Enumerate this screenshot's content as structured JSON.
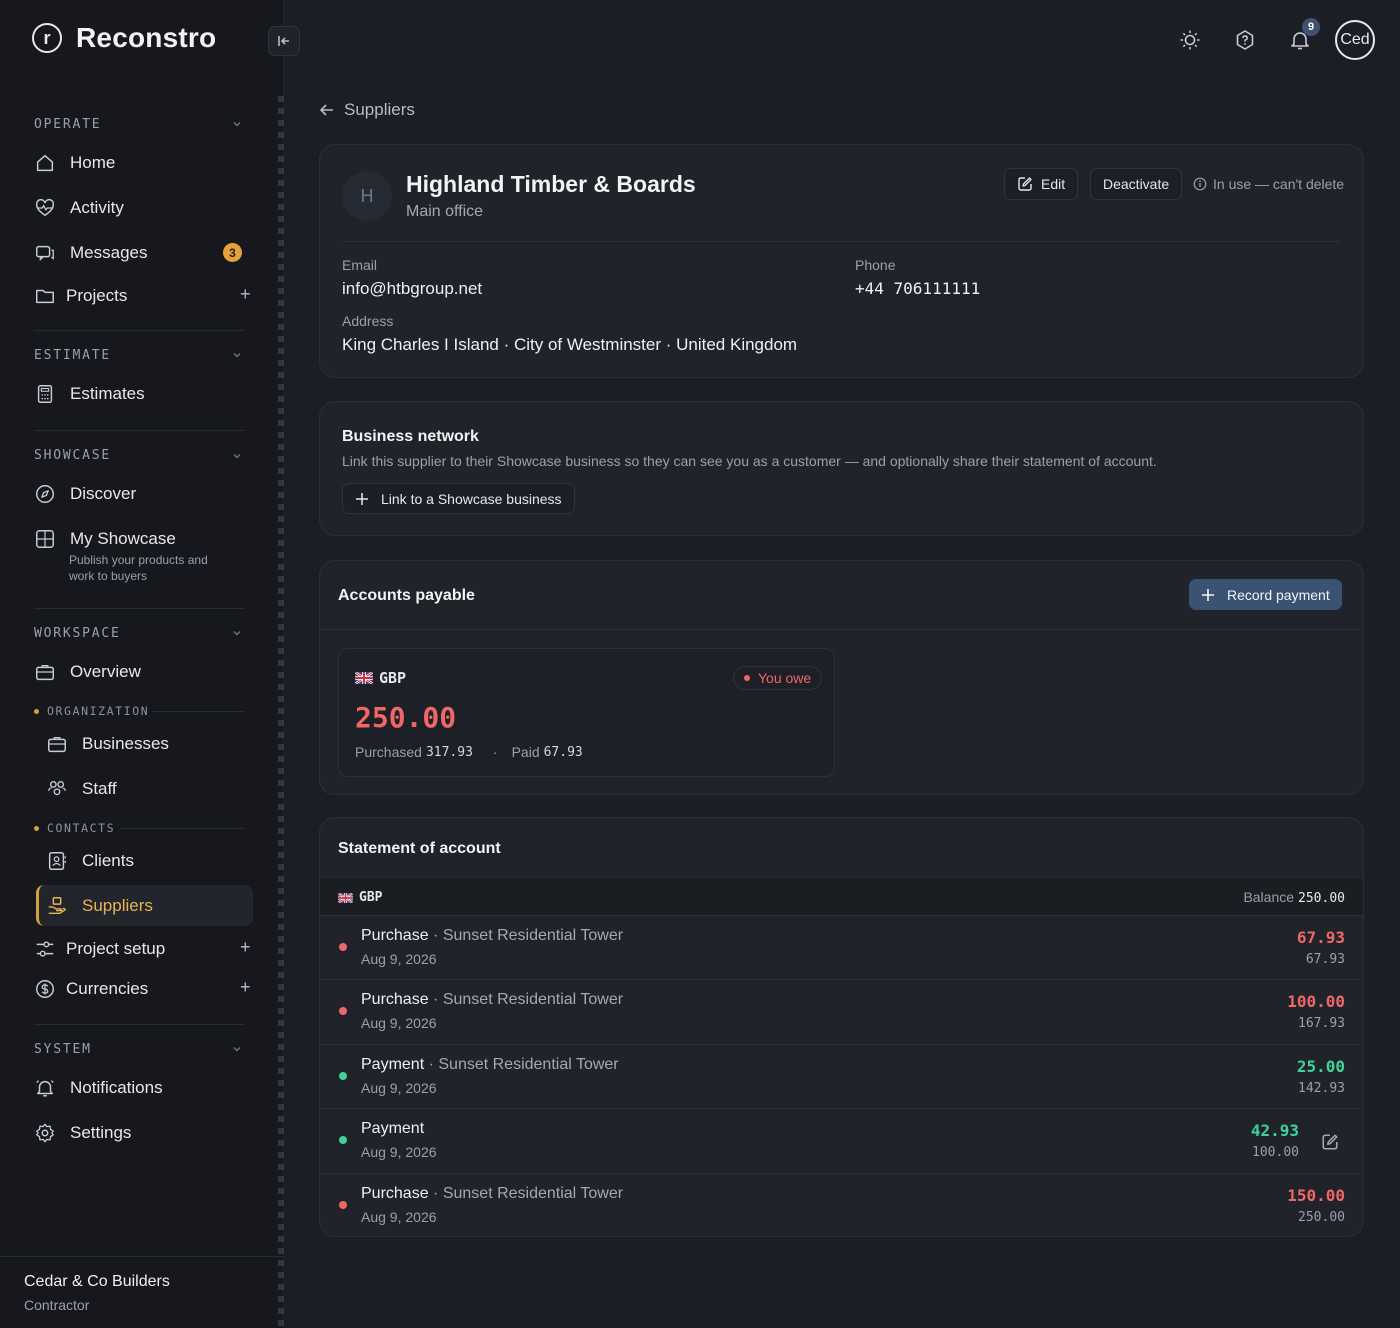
{
  "app": {
    "name": "Reconstro",
    "logo_letter": "r"
  },
  "sidebar": {
    "sections": {
      "operate": "OPERATE",
      "estimate": "ESTIMATE",
      "showcase": "SHOWCASE",
      "workspace": "WORKSPACE",
      "system": "SYSTEM"
    },
    "items": {
      "home": "Home",
      "activity": "Activity",
      "messages": "Messages",
      "messages_badge": "3",
      "projects": "Projects",
      "estimates": "Estimates",
      "discover": "Discover",
      "my_showcase": "My Showcase",
      "my_showcase_sub": "Publish your products and work to buyers",
      "overview": "Overview",
      "organization": "ORGANIZATION",
      "businesses": "Businesses",
      "staff": "Staff",
      "contacts": "CONTACTS",
      "clients": "Clients",
      "suppliers": "Suppliers",
      "project_setup": "Project setup",
      "currencies": "Currencies",
      "notifications": "Notifications",
      "settings": "Settings"
    },
    "plus": "+",
    "footer": {
      "org_name": "Cedar & Co Builders",
      "org_role": "Contractor"
    }
  },
  "topbar": {
    "notification_count": "9",
    "avatar_text": "Ced"
  },
  "breadcrumb": {
    "back_label": "Suppliers"
  },
  "supplier": {
    "avatar_letter": "H",
    "name": "Highland Timber & Boards",
    "subtitle": "Main office",
    "edit_label": "Edit",
    "deactivate_label": "Deactivate",
    "in_use_note": "In use — can't delete",
    "email_label": "Email",
    "email": "info@htbgroup.net",
    "phone_label": "Phone",
    "phone": "+44 706111111",
    "address_label": "Address",
    "address": "King Charles I Island · City of Westminster · United Kingdom"
  },
  "business_network": {
    "title": "Business network",
    "description": "Link this supplier to their Showcase business so they can see you as a customer — and optionally share their statement of account.",
    "link_button": "Link to a Showcase business"
  },
  "accounts_payable": {
    "title": "Accounts payable",
    "record_button": "Record payment",
    "currency": "GBP",
    "status": "You owe",
    "amount": "250.00",
    "purchased_label": "Purchased",
    "purchased": "317.93",
    "separator": "·",
    "paid_label": "Paid",
    "paid": "67.93"
  },
  "statement": {
    "title": "Statement of account",
    "currency": "GBP",
    "balance_label": "Balance",
    "balance": "250.00",
    "rows": [
      {
        "type": "Purchase",
        "project": "· Sunset Residential Tower",
        "date": "Aug 9, 2026",
        "amount": "67.93",
        "running": "67.93"
      },
      {
        "type": "Purchase",
        "project": "· Sunset Residential Tower",
        "date": "Aug 9, 2026",
        "amount": "100.00",
        "running": "167.93"
      },
      {
        "type": "Payment",
        "project": "· Sunset Residential Tower",
        "date": "Aug 9, 2026",
        "amount": "25.00",
        "running": "142.93"
      },
      {
        "type": "Payment",
        "project": "",
        "date": "Aug 9, 2026",
        "amount": "42.93",
        "running": "100.00"
      },
      {
        "type": "Purchase",
        "project": "· Sunset Residential Tower",
        "date": "Aug 9, 2026",
        "amount": "150.00",
        "running": "250.00"
      }
    ]
  },
  "colors": {
    "accent": "#d4a23d",
    "owe": "#f06767",
    "paid": "#3dd39a",
    "primary_button": "#3a5373"
  }
}
